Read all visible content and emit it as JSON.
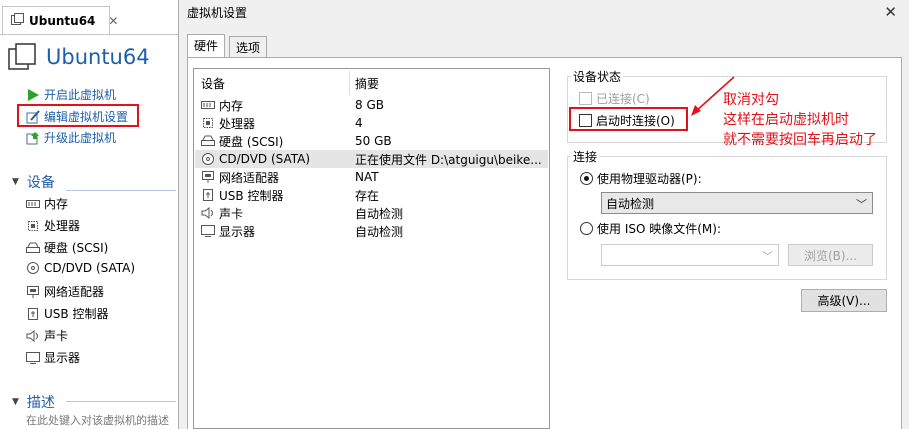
{
  "vm_tab": {
    "title": "Ubuntu64",
    "close": "✕"
  },
  "vm_name": "Ubuntu64",
  "actions": [
    {
      "label": "开启此虚拟机",
      "icon": "play-icon"
    },
    {
      "label": "编辑虚拟机设置",
      "icon": "edit-settings-icon"
    },
    {
      "label": "升级此虚拟机",
      "icon": "upgrade-icon"
    }
  ],
  "devices_section": {
    "label": "设备"
  },
  "left_devices": [
    {
      "name": "内存",
      "icon": "memory-icon"
    },
    {
      "name": "处理器",
      "icon": "cpu-icon"
    },
    {
      "name": "硬盘 (SCSI)",
      "icon": "harddisk-icon"
    },
    {
      "name": "CD/DVD (SATA)",
      "icon": "cdrom-icon"
    },
    {
      "name": "网络适配器",
      "icon": "network-icon"
    },
    {
      "name": "USB 控制器",
      "icon": "usb-icon"
    },
    {
      "name": "声卡",
      "icon": "sound-icon"
    },
    {
      "name": "显示器",
      "icon": "display-icon"
    }
  ],
  "description_section": {
    "label": "描述",
    "placeholder": "在此处键入对该虚拟机的描述"
  },
  "dialog": {
    "title": "虚拟机设置",
    "close": "✕",
    "tabs": [
      "硬件",
      "选项"
    ],
    "list_headers": {
      "device": "设备",
      "summary": "摘要"
    },
    "hardware": [
      {
        "device": "内存",
        "summary": "8 GB",
        "icon": "memory-icon"
      },
      {
        "device": "处理器",
        "summary": "4",
        "icon": "cpu-icon"
      },
      {
        "device": "硬盘 (SCSI)",
        "summary": "50 GB",
        "icon": "harddisk-icon"
      },
      {
        "device": "CD/DVD (SATA)",
        "summary": "正在使用文件 D:\\atguigu\\beike...",
        "icon": "cdrom-icon"
      },
      {
        "device": "网络适配器",
        "summary": "NAT",
        "icon": "network-icon"
      },
      {
        "device": "USB 控制器",
        "summary": "存在",
        "icon": "usb-icon"
      },
      {
        "device": "声卡",
        "summary": "自动检测",
        "icon": "sound-icon"
      },
      {
        "device": "显示器",
        "summary": "自动检测",
        "icon": "display-icon"
      }
    ],
    "device_status": {
      "legend": "设备状态",
      "connected": "已连接(C)",
      "connect_at_power_on": "启动时连接(O)"
    },
    "connection": {
      "legend": "连接",
      "use_physical": "使用物理驱动器(P):",
      "physical_value": "自动检测",
      "use_iso": "使用 ISO 映像文件(M):",
      "iso_value": "",
      "browse": "浏览(B)..."
    },
    "advanced": "高级(V)..."
  },
  "annotation": {
    "line1": "取消对勾",
    "line2": "这样在启动虚拟机时",
    "line3": "就不需要按回车再启动了",
    "color": "#e0121a"
  }
}
